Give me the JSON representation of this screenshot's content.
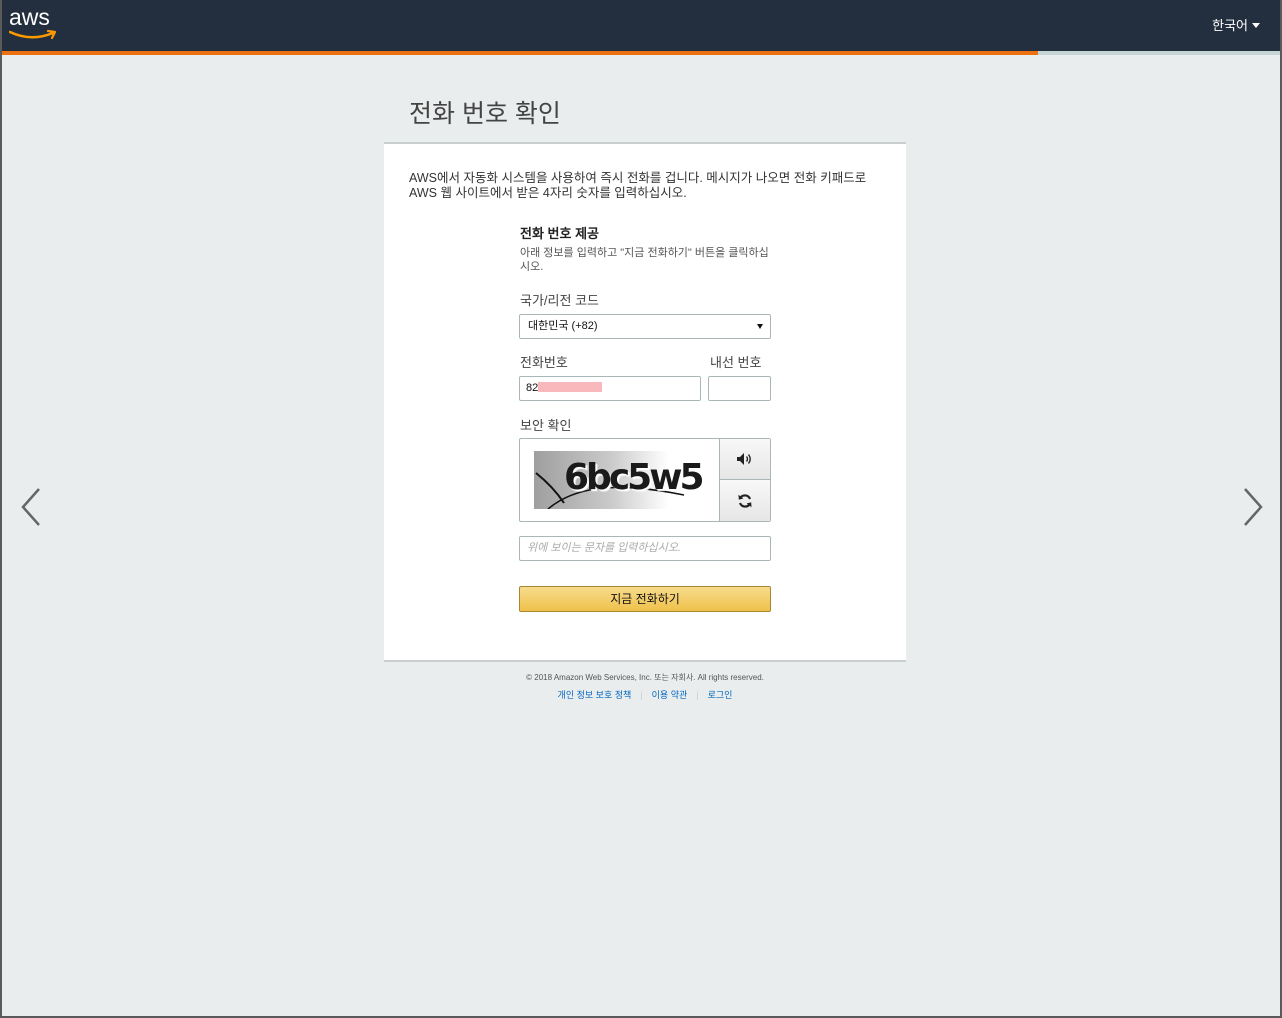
{
  "header": {
    "logo_text": "aws",
    "language": "한국어"
  },
  "progress": {
    "fraction": 0.81
  },
  "page": {
    "title": "전화 번호 확인",
    "intro": "AWS에서 자동화 시스템을 사용하여 즉시 전화를 겁니다. 메시지가 나오면 전화 키패드로 AWS 웹 사이트에서 받은 4자리 숫자를 입력하십시오."
  },
  "form": {
    "section_title": "전화 번호 제공",
    "section_desc": "아래 정보를 입력하고 \"지금 전화하기\" 버튼을 클릭하십시오.",
    "country_label": "국가/리전 코드",
    "country_value": "대한민국 (+82)",
    "phone_label": "전화번호",
    "phone_value": "82",
    "extension_label": "내선 번호",
    "extension_value": "",
    "security_label": "보안 확인",
    "captcha_text": "6bc5w5",
    "captcha_placeholder": "위에 보이는 문자를 입력하십시오.",
    "call_button": "지금 전화하기"
  },
  "footer": {
    "copyright": "© 2018 Amazon Web Services, Inc. 또는 자회사. All rights reserved.",
    "links": [
      "개인 정보 보호 정책",
      "이용 약관",
      "로그인"
    ]
  },
  "icons": {
    "audio": "speaker-icon",
    "refresh": "refresh-icon",
    "prev": "chevron-left-icon",
    "next": "chevron-right-icon"
  }
}
